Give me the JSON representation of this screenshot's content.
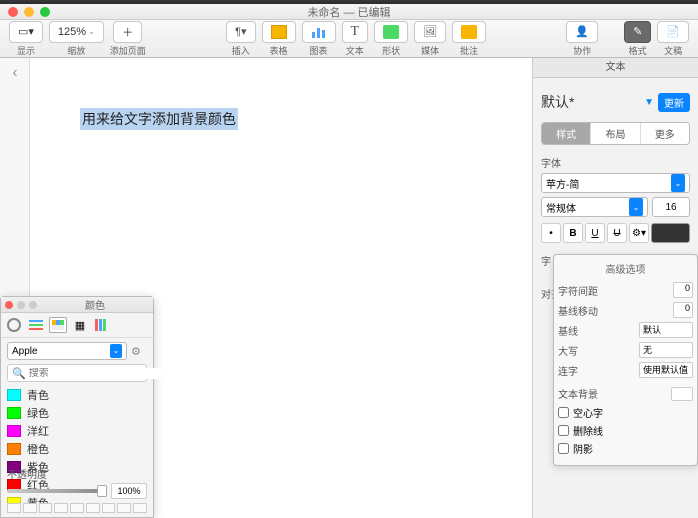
{
  "window": {
    "title": "未命名 — 已编辑"
  },
  "toolbar": {
    "view_label": "显示",
    "zoom_value": "125%",
    "zoom_label": "缩放",
    "addpage_label": "添加页面",
    "insert_label": "插入",
    "table_label": "表格",
    "chart_label": "图表",
    "text_label": "文本",
    "shape_label": "形状",
    "media_label": "媒体",
    "comment_label": "批注",
    "collab_label": "协作",
    "format_label": "格式",
    "document_label": "文稿"
  },
  "document": {
    "selected_text": "用来给文字添加背景颜色"
  },
  "inspector": {
    "top_tab": "文本",
    "style_name": "默认*",
    "update_btn": "更新",
    "tabs": {
      "style": "样式",
      "layout": "布局",
      "more": "更多"
    },
    "font_section": "字体",
    "font_family": "苹方-简",
    "font_weight": "常规体",
    "font_size": "16",
    "char_label": "字",
    "align_label": "对齐"
  },
  "advanced": {
    "title": "高级选项",
    "char_spacing_label": "字符间距",
    "char_spacing_val": "0",
    "baseline_shift_label": "基线移动",
    "baseline_shift_val": "0",
    "baseline_label": "基线",
    "baseline_val": "默认",
    "caps_label": "大写",
    "caps_val": "无",
    "ligature_label": "连字",
    "ligature_val": "使用默认值",
    "textbg_label": "文本背景",
    "outline_label": "空心字",
    "strike_label": "删除线",
    "shadow_label": "阴影"
  },
  "colors": {
    "title": "颜色",
    "palette": "Apple",
    "search_ph": "搜索",
    "items": [
      {
        "name": "青色",
        "hex": "#00ffff"
      },
      {
        "name": "绿色",
        "hex": "#00ff00"
      },
      {
        "name": "洋红",
        "hex": "#ff00ff"
      },
      {
        "name": "橙色",
        "hex": "#ff8000"
      },
      {
        "name": "紫色",
        "hex": "#800080"
      },
      {
        "name": "红色",
        "hex": "#ff0000"
      },
      {
        "name": "黄色",
        "hex": "#ffff00"
      }
    ],
    "opacity_label": "不透明度",
    "opacity_value": "100%"
  }
}
